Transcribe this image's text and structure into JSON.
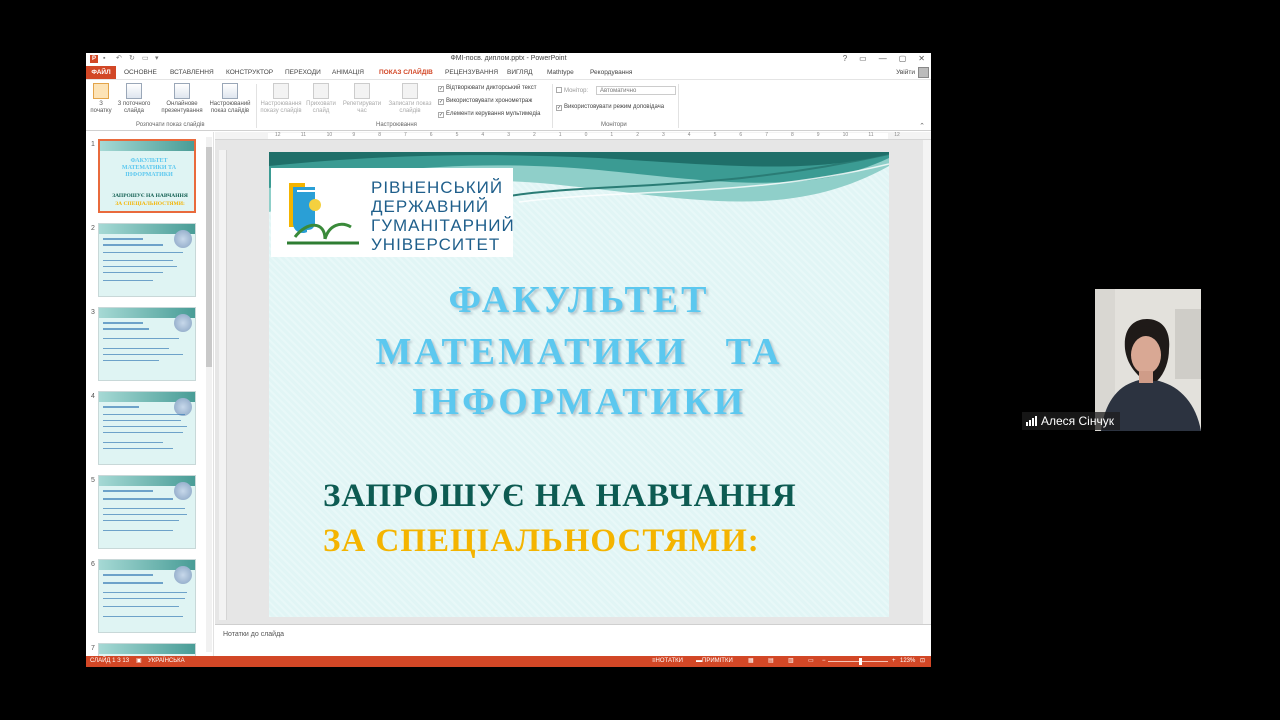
{
  "window": {
    "title": "ФМІ-посв. диплом.pptx - PowerPoint",
    "controls": [
      "?",
      "▭",
      "—",
      "▢",
      "✕"
    ]
  },
  "ribbon_tabs": {
    "file": "ФАЙЛ",
    "items": [
      "ОСНОВНЕ",
      "ВСТАВЛЕННЯ",
      "КОНСТРУКТОР",
      "ПЕРЕХОДИ",
      "АНІМАЦІЯ",
      "ПОКАЗ СЛАЙДІВ",
      "РЕЦЕНЗУВАННЯ",
      "ВИГЛЯД",
      "Mathtype",
      "Рекордування"
    ],
    "active": "ПОКАЗ СЛАЙДІВ",
    "user": "Увійти"
  },
  "ribbon": {
    "buttons": [
      {
        "label": "З початку",
        "state": "selected"
      },
      {
        "label": "З поточного слайда",
        "state": "normal"
      },
      {
        "label": "Онлайнове презентування",
        "state": "normal"
      },
      {
        "label": "Настроюваний показ слайдів",
        "state": "normal"
      },
      {
        "label": "Настроювання показу слайдів",
        "state": "disabled"
      },
      {
        "label": "Приховати слайд",
        "state": "disabled"
      },
      {
        "label": "Репетирувати час",
        "state": "disabled"
      },
      {
        "label": "Записати показ слайдів",
        "state": "disabled"
      }
    ],
    "checks": [
      {
        "label": "Відтворювати дикторський текст",
        "checked": true
      },
      {
        "label": "Використовувати хронометраж",
        "checked": true
      },
      {
        "label": "Елементи керування мультимедіа",
        "checked": true
      }
    ],
    "monitor_label": "Монітор:",
    "monitor_value": "Автоматично",
    "presenter_view": "Використовувати режим доповідача",
    "groups": [
      "Розпочати показ слайдів",
      "Настроювання",
      "Монітори"
    ]
  },
  "thumbnails": {
    "numbers": [
      "1",
      "2",
      "3",
      "4",
      "5",
      "6",
      "7"
    ],
    "slide1_title": "ФАКУЛЬТЕТ МАТЕМАТИКИ ТА ІНФОРМАТИКИ",
    "slide1_sub1": "ЗАПРОШУЄ НА НАВЧАННЯ",
    "slide1_sub2": "ЗА СПЕЦІАЛЬНОСТЯМИ:"
  },
  "ruler": {
    "marks": [
      "12",
      "11",
      "10",
      "9",
      "8",
      "7",
      "6",
      "5",
      "4",
      "3",
      "2",
      "1",
      "0",
      "1",
      "2",
      "3",
      "4",
      "5",
      "6",
      "7",
      "8",
      "9",
      "10",
      "11",
      "12"
    ]
  },
  "slide": {
    "logo_lines": [
      "РІВНЕНСЬКИЙ",
      "ДЕРЖАВНИЙ",
      "ГУМАНІТАРНИЙ",
      "УНІВЕРСИТЕТ"
    ],
    "faculty_lines": [
      "ФАКУЛЬТЕТ",
      "МАТЕМАТИКИ   ТА",
      "ІНФОРМАТИКИ"
    ],
    "invite": "ЗАПРОШУЄ НА НАВЧАННЯ",
    "specialties": "ЗА СПЕЦІАЛЬНОСТЯМИ:",
    "colors": {
      "title": "#5cc8ef",
      "invite": "#0d5b52",
      "specialties": "#f4b400"
    }
  },
  "notes_placeholder": "Нотатки до слайда",
  "status": {
    "slide": "СЛАЙД 1 З 13",
    "language": "УКРАЇНСЬКА",
    "notes": "НОТАТКИ",
    "comments": "ПРИМІТКИ",
    "zoom": "123%"
  },
  "participant": {
    "name": "Алеся Сінчук"
  }
}
